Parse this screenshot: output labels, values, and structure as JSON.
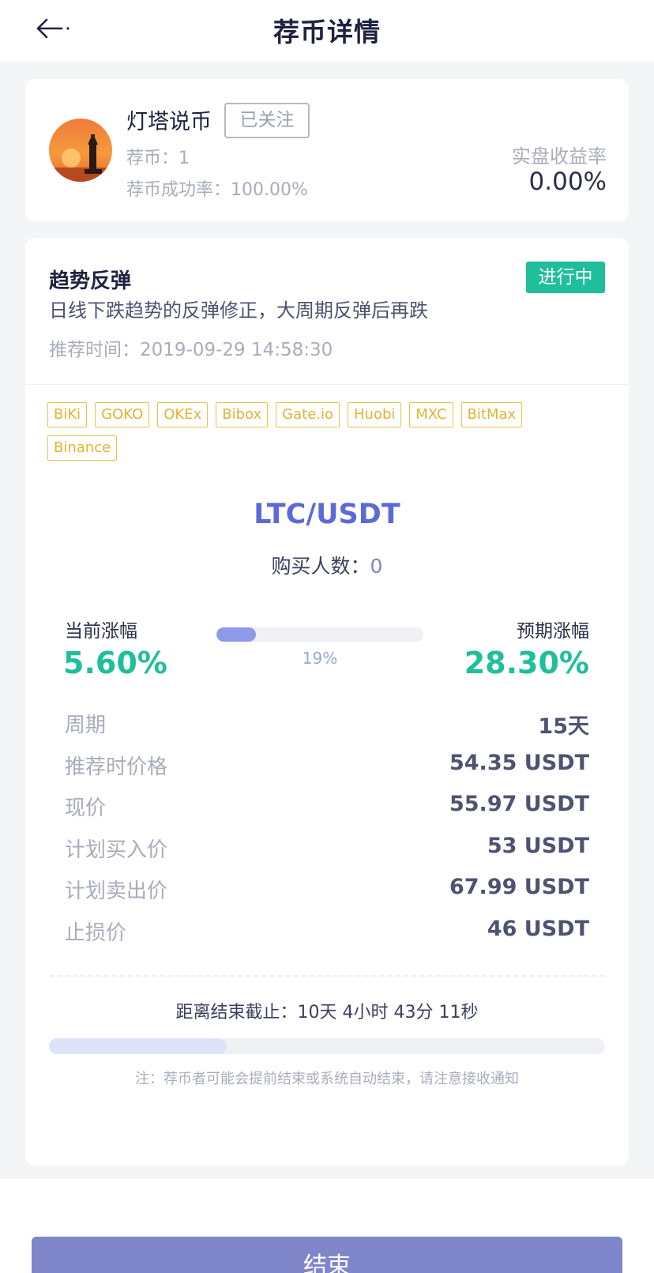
{
  "header": {
    "title": "荐币详情"
  },
  "author": {
    "name": "灯塔说币",
    "follow_label": "已关注",
    "rec_count_label": "荐币：",
    "rec_count": "1",
    "success_rate_label": "荐币成功率：",
    "success_rate": "100.00%",
    "real_return_label": "实盘收益率",
    "real_return": "0.00%"
  },
  "recommendation": {
    "title": "趋势反弹",
    "status": "进行中",
    "description": "日线下跌趋势的反弹修正，大周期反弹后再跌",
    "time_label": "推荐时间：",
    "time": "2019-09-29 14:58:30",
    "exchanges": [
      "BiKi",
      "GOKO",
      "OKEx",
      "Bibox",
      "Gate.io",
      "Huobi",
      "MXC",
      "BitMax",
      "Binance"
    ],
    "pair": "LTC/USDT",
    "buyers_label": "购买人数：",
    "buyers": "0",
    "current_gain_label": "当前涨幅",
    "current_gain": "5.60%",
    "expected_gain_label": "预期涨幅",
    "expected_gain": "28.30%",
    "progress_label": "19%",
    "progress_fraction": 0.19,
    "details": [
      {
        "label": "周期",
        "value": "15天"
      },
      {
        "label": "推荐时价格",
        "value": "54.35 USDT"
      },
      {
        "label": "现价",
        "value": "55.97 USDT"
      },
      {
        "label": "计划买入价",
        "value": "53 USDT"
      },
      {
        "label": "计划卖出价",
        "value": "67.99 USDT"
      },
      {
        "label": "止损价",
        "value": "46 USDT"
      }
    ],
    "countdown_label": "距离结束截止：",
    "countdown": "10天 4小时 43分 11秒",
    "time_elapsed_fraction": 0.32,
    "note": "注：荐币者可能会提前结束或系统自动结束，请注意接收通知"
  },
  "footer": {
    "end_label": "结束"
  },
  "colors": {
    "accent": "#5b6ad8",
    "positive": "#1fbf9c",
    "tag": "#e3b432",
    "button": "#7f86c9"
  },
  "icons": {
    "back": "arrow-left-icon",
    "avatar": "lighthouse-sunset-avatar"
  }
}
